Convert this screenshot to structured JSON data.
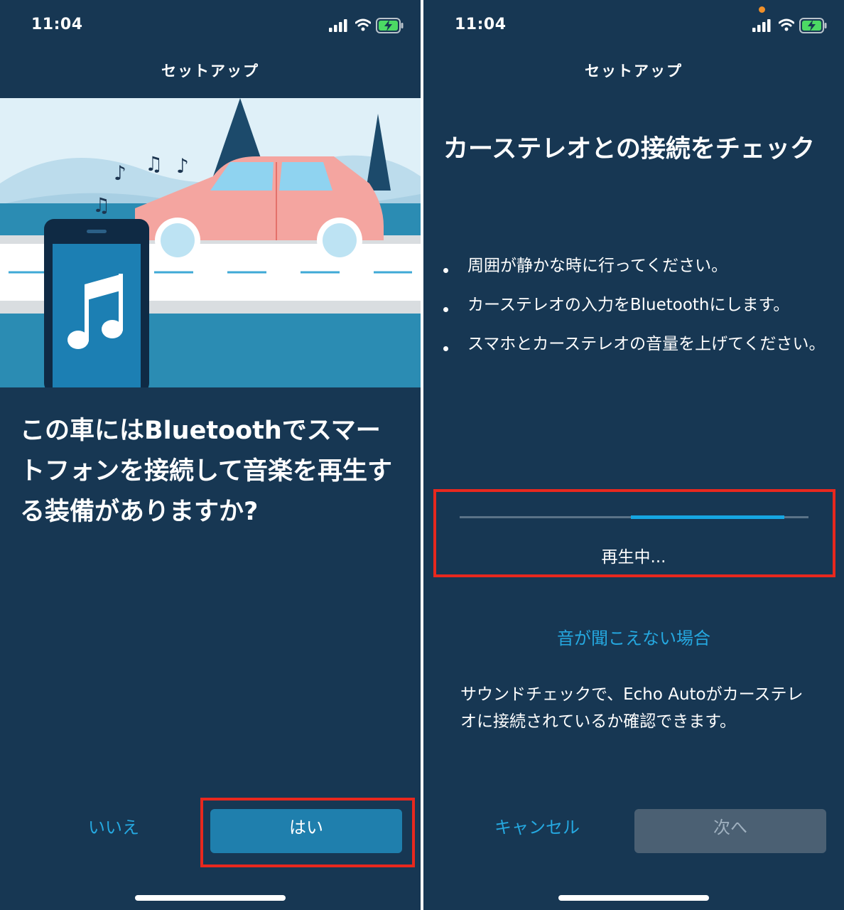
{
  "left_screen": {
    "status": {
      "time": "11:04"
    },
    "nav_title": "セットアップ",
    "illustration": {
      "icon": "phone-music-car-illustration"
    },
    "question": "この車にはBluetoothでスマートフォンを接続して音楽を再生する装備がありますか?",
    "buttons": {
      "no": "いいえ",
      "yes": "はい"
    }
  },
  "right_screen": {
    "status": {
      "time": "11:04"
    },
    "nav_title": "セットアップ",
    "heading": "カーステレオとの接続をチェック",
    "bullets": [
      "周囲が静かな時に行ってください。",
      "カーステレオの入力をBluetoothにします。",
      "スマホとカーステレオの音量を上げてください。"
    ],
    "progress": {
      "label": "再生中...",
      "fill_start": 0.49,
      "fill_end": 0.93
    },
    "help_link": "音が聞こえない場合",
    "description": "サウンドチェックで、Echo Autoがカーステレオに接続されているか確認できます。",
    "buttons": {
      "cancel": "キャンセル",
      "next": "次へ"
    }
  },
  "colors": {
    "background": "#173753",
    "accent_link": "#25a8e0",
    "primary_button": "#1f7fad",
    "disabled_button": "#4b6073",
    "progress_fill": "#16a6e2",
    "highlight_box": "#e8281e",
    "car": "#f4a5a0",
    "battery": "#4cd964"
  }
}
